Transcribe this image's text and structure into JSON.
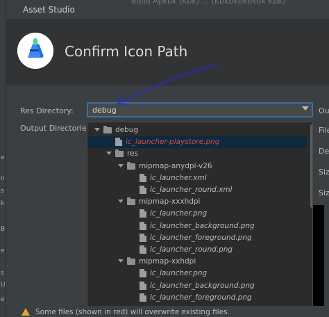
{
  "window": {
    "title": "Asset Studio",
    "background_tabs": "Build Apkbk (Kbk) ... (Kbkbkbkbkbk Kbk)"
  },
  "header": {
    "title": "Confirm Icon Path"
  },
  "form": {
    "res_directory_label": "Res Directory:",
    "res_directory_value": "debug",
    "output_directories_label": "Output Directories:"
  },
  "tree": [
    {
      "label": "debug",
      "type": "folder",
      "depth": 0,
      "expanded": true
    },
    {
      "label": "ic_launcher-playstore.png",
      "type": "file",
      "depth": 1,
      "overwrite": true,
      "selected": true
    },
    {
      "label": "res",
      "type": "folder",
      "depth": 1,
      "expanded": true
    },
    {
      "label": "mipmap-anydpi-v26",
      "type": "folder",
      "depth": 2,
      "expanded": true
    },
    {
      "label": "ic_launcher.xml",
      "type": "file",
      "depth": 3
    },
    {
      "label": "ic_launcher_round.xml",
      "type": "file",
      "depth": 3
    },
    {
      "label": "mipmap-xxxhdpi",
      "type": "folder",
      "depth": 2,
      "expanded": true
    },
    {
      "label": "ic_launcher.png",
      "type": "file",
      "depth": 3
    },
    {
      "label": "ic_launcher_background.png",
      "type": "file",
      "depth": 3
    },
    {
      "label": "ic_launcher_foreground.png",
      "type": "file",
      "depth": 3
    },
    {
      "label": "ic_launcher_round.png",
      "type": "file",
      "depth": 3
    },
    {
      "label": "mipmap-xxhdpi",
      "type": "folder",
      "depth": 2,
      "expanded": true
    },
    {
      "label": "ic_launcher.png",
      "type": "file",
      "depth": 3
    },
    {
      "label": "ic_launcher_background.png",
      "type": "file",
      "depth": 3
    },
    {
      "label": "ic_launcher_foreground.png",
      "type": "file",
      "depth": 3
    }
  ],
  "right_panel": {
    "output_label": "Outp",
    "file_type_label": "File T",
    "density_label": "Dens",
    "size_label_1": "Size (",
    "size_label_2": "Size ("
  },
  "ide_strip": [
    "e",
    "n",
    "s",
    "k",
    "B",
    "e",
    "s",
    "U",
    "e"
  ],
  "warning": {
    "text": "Some files (shown in red) will overwrite existing files."
  },
  "colors": {
    "accent": "#3d6fa8",
    "overwrite": "#d04a4a",
    "annotation": "#1f2be0",
    "warning": "#e0a82e"
  },
  "icons": {
    "logo": "android-logo-icon",
    "warning": "warning-icon",
    "folder": "folder-icon",
    "file": "file-icon",
    "expand": "chevron-down-icon"
  }
}
